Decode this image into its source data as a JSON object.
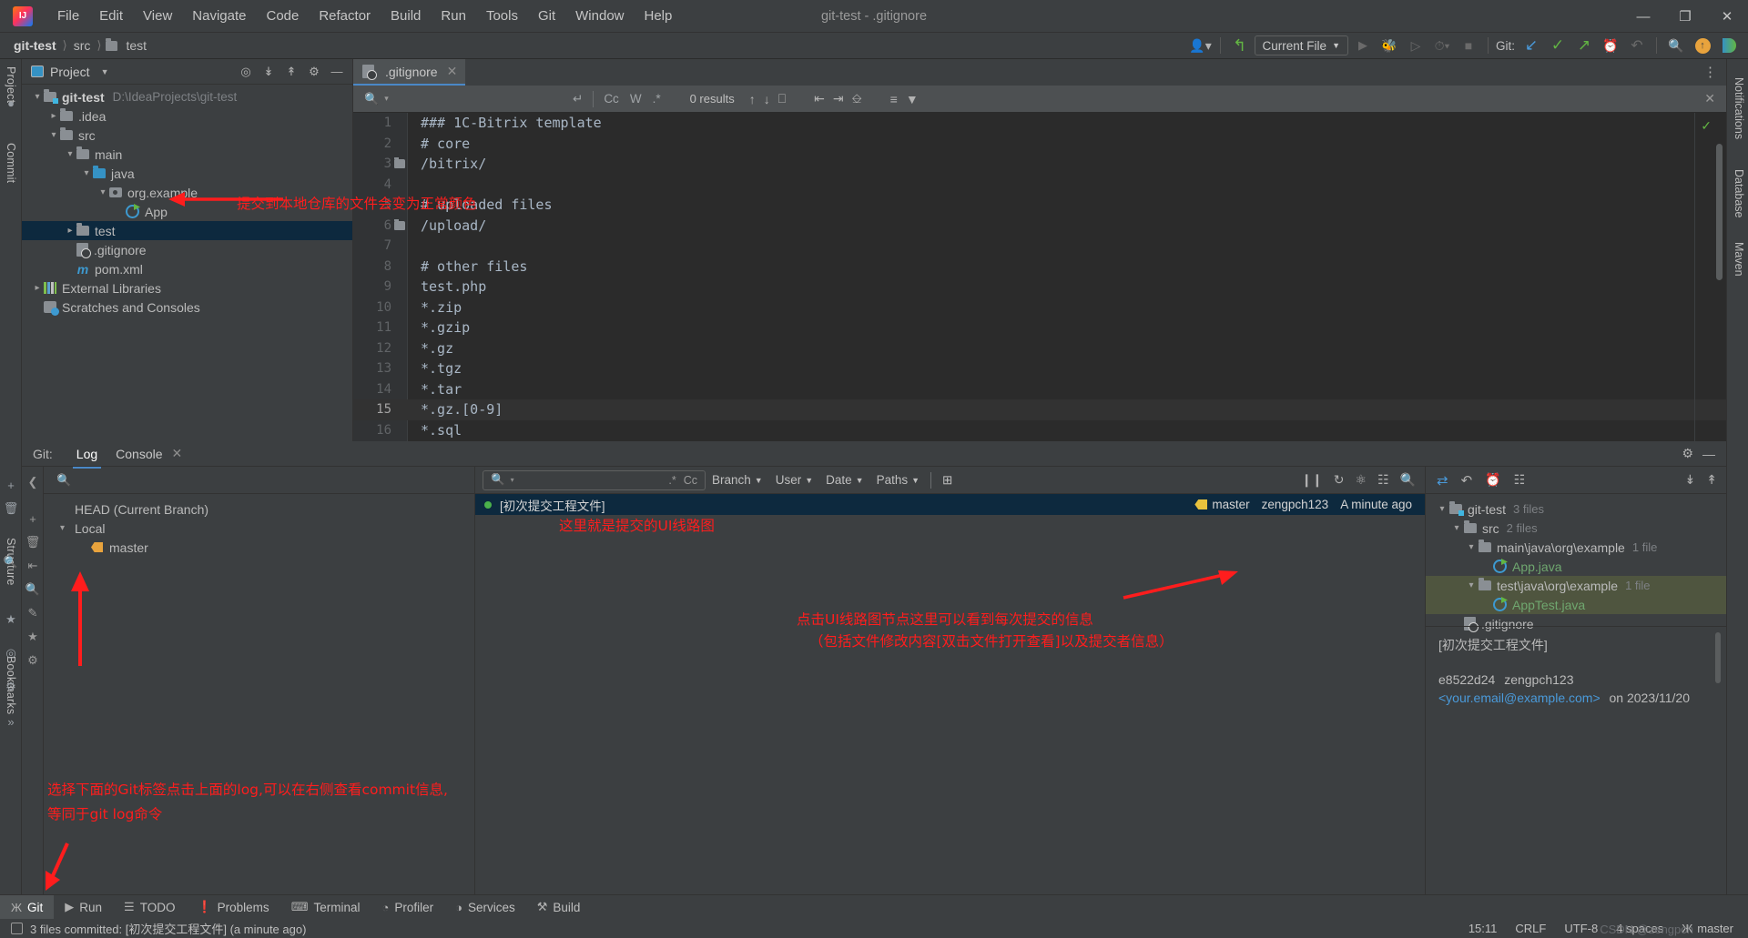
{
  "window": {
    "title": "git-test - .gitignore",
    "minimize": "—",
    "maximize": "❐",
    "close": "✕"
  },
  "menubar": [
    "File",
    "Edit",
    "View",
    "Navigate",
    "Code",
    "Refactor",
    "Build",
    "Run",
    "Tools",
    "Git",
    "Window",
    "Help"
  ],
  "breadcrumb": {
    "project": "git-test",
    "src": "src",
    "folder": "test"
  },
  "toolbar": {
    "run_config": "Current File",
    "git_label": "Git:",
    "icons": [
      "user-settings-icon",
      "undo-arrow-icon",
      "run-icon",
      "debug-icon",
      "run-coverage-icon",
      "profiler-icon",
      "stop-icon",
      "update-project-icon",
      "commit-icon",
      "push-icon",
      "history-icon",
      "rollback-icon",
      "search-everywhere-icon",
      "notifications-icon",
      "ai-assistant-icon"
    ]
  },
  "left_strip": {
    "tabs": [
      "Project",
      "Commit",
      "Structure",
      "Bookmarks"
    ]
  },
  "right_strip": {
    "tabs": [
      "Notifications",
      "Database",
      "Maven"
    ]
  },
  "project_panel": {
    "title": "Project",
    "actions": [
      "locate-icon",
      "expand-all-icon",
      "collapse-all-icon",
      "settings-gear-icon",
      "hide-icon"
    ],
    "tree": [
      {
        "label": "git-test",
        "path": "D:\\IdeaProjects\\git-test",
        "indent": 0,
        "arrow": "⌄",
        "icon": "module-folder",
        "bold": true
      },
      {
        "label": ".idea",
        "path": "",
        "indent": 1,
        "arrow": "›",
        "icon": "folder"
      },
      {
        "label": "src",
        "path": "",
        "indent": 1,
        "arrow": "⌄",
        "icon": "folder"
      },
      {
        "label": "main",
        "path": "",
        "indent": 2,
        "arrow": "⌄",
        "icon": "folder"
      },
      {
        "label": "java",
        "path": "",
        "indent": 3,
        "arrow": "⌄",
        "icon": "source-folder"
      },
      {
        "label": "org.example",
        "path": "",
        "indent": 4,
        "arrow": "⌄",
        "icon": "package"
      },
      {
        "label": "App",
        "path": "",
        "indent": 5,
        "arrow": "",
        "icon": "java-class"
      },
      {
        "label": "test",
        "path": "",
        "indent": 2,
        "arrow": "›",
        "icon": "folder",
        "selected": true
      },
      {
        "label": ".gitignore",
        "path": "",
        "indent": 2,
        "arrow": "",
        "icon": "gitignore-file"
      },
      {
        "label": "pom.xml",
        "path": "",
        "indent": 2,
        "arrow": "",
        "icon": "maven-file"
      },
      {
        "label": "External Libraries",
        "path": "",
        "indent": 0,
        "arrow": "›",
        "icon": "libraries"
      },
      {
        "label": "Scratches and Consoles",
        "path": "",
        "indent": 0,
        "arrow": "",
        "icon": "scratches"
      }
    ]
  },
  "editor": {
    "tab_label": ".gitignore",
    "tab_close": "✕",
    "find": {
      "placeholder": "",
      "match_case": "Cc",
      "words": "W",
      "regex": ".*",
      "results": "0 results",
      "close": "✕"
    },
    "lines": [
      {
        "n": "1",
        "text": "### 1C-Bitrix template",
        "fold": false
      },
      {
        "n": "2",
        "text": "# core",
        "fold": false
      },
      {
        "n": "3",
        "text": "/bitrix/",
        "fold": true
      },
      {
        "n": "4",
        "text": "",
        "fold": false
      },
      {
        "n": "5",
        "text": "# uploaded files",
        "fold": false
      },
      {
        "n": "6",
        "text": "/upload/",
        "fold": true
      },
      {
        "n": "7",
        "text": "",
        "fold": false
      },
      {
        "n": "8",
        "text": "# other files",
        "fold": false
      },
      {
        "n": "9",
        "text": "test.php",
        "fold": false
      },
      {
        "n": "10",
        "text": "*.zip",
        "fold": false
      },
      {
        "n": "11",
        "text": "*.gzip",
        "fold": false
      },
      {
        "n": "12",
        "text": "*.gz",
        "fold": false
      },
      {
        "n": "13",
        "text": "*.tgz",
        "fold": false
      },
      {
        "n": "14",
        "text": "*.tar",
        "fold": false
      },
      {
        "n": "15",
        "text": "*.gz.[0-9]",
        "fold": false,
        "current": true
      },
      {
        "n": "16",
        "text": "*.sql",
        "fold": false
      }
    ]
  },
  "git_window": {
    "label": "Git:",
    "tabs": [
      {
        "label": "Log",
        "active": true
      },
      {
        "label": "Console",
        "active": false
      }
    ],
    "console_close": "✕",
    "head_actions": [
      "settings-gear-icon",
      "hide-icon"
    ],
    "branches": {
      "search_placeholder": "",
      "head": "HEAD (Current Branch)",
      "local_group": "Local",
      "local_branches": [
        "master"
      ]
    },
    "log": {
      "search_placeholder": "",
      "regex_btn": ".*",
      "case_btn": "Cc",
      "filters": [
        "Branch",
        "User",
        "Date",
        "Paths"
      ],
      "toolbar_icons": [
        "intellisort-icon",
        "refresh-icon",
        "highlight-icon",
        "show-graph-icon",
        "find-icon"
      ],
      "commits": [
        {
          "subject": "[初次提交工程文件]",
          "branch": "master",
          "author": "zengpch123",
          "date": "A minute ago",
          "selected": true
        }
      ]
    },
    "details": {
      "tree": [
        {
          "label": "git-test",
          "count": "3 files",
          "indent": 0,
          "arrow": "⌄",
          "icon": "module-folder"
        },
        {
          "label": "src",
          "count": "2 files",
          "indent": 1,
          "arrow": "⌄",
          "icon": "folder"
        },
        {
          "label": "main\\java\\org\\example",
          "count": "1 file",
          "indent": 2,
          "arrow": "⌄",
          "icon": "folder"
        },
        {
          "label": "App.java",
          "count": "",
          "indent": 3,
          "arrow": "",
          "icon": "java-class",
          "green": true
        },
        {
          "label": "test\\java\\org\\example",
          "count": "1 file",
          "indent": 2,
          "arrow": "⌄",
          "icon": "folder",
          "selected": true
        },
        {
          "label": "AppTest.java",
          "count": "",
          "indent": 3,
          "arrow": "",
          "icon": "java-class",
          "green": true,
          "selected": true
        },
        {
          "label": ".gitignore",
          "count": "",
          "indent": 1,
          "arrow": "",
          "icon": "gitignore-file"
        }
      ],
      "message": "[初次提交工程文件]",
      "hash": "e8522d24",
      "author": "zengpch123",
      "email": "<your.email@example.com>",
      "on_date": "on 2023/11/20"
    }
  },
  "bottom_tabs": [
    {
      "label": "Git",
      "icon": "git-branch-icon",
      "active": true
    },
    {
      "label": "Run",
      "icon": "run-triangle-icon",
      "active": false
    },
    {
      "label": "TODO",
      "icon": "todo-list-icon",
      "active": false
    },
    {
      "label": "Problems",
      "icon": "problems-icon",
      "active": false
    },
    {
      "label": "Terminal",
      "icon": "terminal-icon",
      "active": false
    },
    {
      "label": "Profiler",
      "icon": "profiler-icon",
      "active": false
    },
    {
      "label": "Services",
      "icon": "services-icon",
      "active": false
    },
    {
      "label": "Build",
      "icon": "build-hammer-icon",
      "active": false
    }
  ],
  "statusbar": {
    "message": "3 files committed: [初次提交工程文件] (a minute ago)",
    "position": "15:11",
    "line_sep": "CRLF",
    "encoding": "UTF-8",
    "indent": "4 spaces",
    "branch": "master"
  },
  "annotations": {
    "app_note": "提交到本地仓库的文件会变为正常颜色",
    "graph_note": "这里就是提交的UI线路图",
    "details_note_1": "点击UI线路图节点这里可以看到每次提交的信息",
    "details_note_2": "（包括文件修改内容[双击文件打开查看]以及提交者信息）",
    "log_note_1": "选择下面的Git标签点击上面的log,可以在右侧查看commit信息,",
    "log_note_2": "等同于git log命令"
  },
  "watermark": "CSDN @zengpch",
  "colors": {
    "accent_blue": "#4a88c7",
    "selection_blue": "#0d293e",
    "selection_green": "#4f553f",
    "annotation_red": "#ff1d1d",
    "added_green": "#6fa76f",
    "panel_bg": "#3c3f41",
    "editor_bg": "#2b2b2b"
  }
}
